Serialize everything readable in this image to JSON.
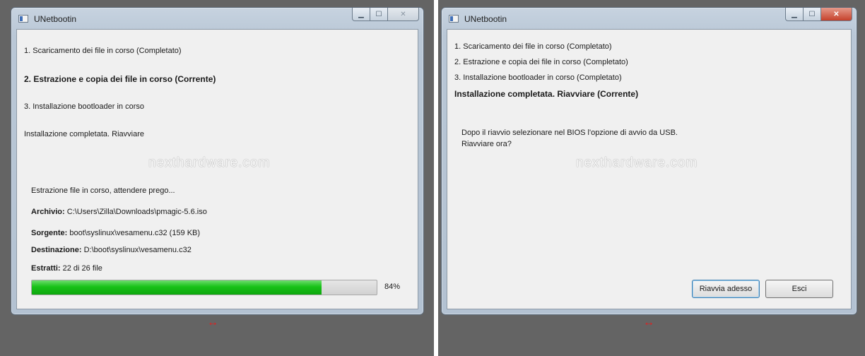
{
  "left_window": {
    "title": "UNetbootin",
    "steps": [
      "1. Scaricamento dei file in corso (Completato)",
      "2. Estrazione e copia dei file in corso (Corrente)",
      "3. Installazione bootloader in corso",
      "Installazione completata. Riavviare"
    ],
    "watermark": "nexthardware.com",
    "status_text": "Estrazione file in corso, attendere prego...",
    "details": {
      "archive_label": "Archivio:",
      "archive_value": "C:\\Users\\Zilla\\Downloads\\pmagic-5.6.iso",
      "source_label": "Sorgente:",
      "source_value": "boot\\syslinux\\vesamenu.c32 (159 KB)",
      "destination_label": "Destinazione:",
      "destination_value": "D:\\boot\\syslinux\\vesamenu.c32",
      "extracted_label": "Estratti:",
      "extracted_value": "22 di 26 file"
    },
    "progress": {
      "fraction": 0.84,
      "label": "84%"
    }
  },
  "right_window": {
    "title": "UNetbootin",
    "steps": [
      "1. Scaricamento dei file in corso (Completato)",
      "2. Estrazione e copia dei file in corso (Completato)",
      "3. Installazione bootloader in corso (Completato)",
      "Installazione completata. Riavviare (Corrente)"
    ],
    "message_line1": "Dopo il riavvio selezionare nel BIOS l'opzione di avvio da USB.",
    "message_line2": "Riavviare ora?",
    "watermark": "nexthardware.com",
    "restart_button": "Riavvia adesso",
    "exit_button": "Esci"
  },
  "caption_icons": [
    "minimize-icon",
    "maximize-icon",
    "close-icon"
  ],
  "expand_icon": "↔",
  "colors": {
    "background": "#646464",
    "progress_fill": "#17c117",
    "expand_icon": "#e02020"
  }
}
